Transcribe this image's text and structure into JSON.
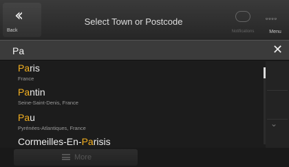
{
  "header": {
    "back_label": "Back",
    "title": "Select Town or Postcode",
    "notifications_label": "Notifications",
    "menu_label": "Menu"
  },
  "search": {
    "value": "Pa"
  },
  "results": [
    {
      "pre": "",
      "match": "Pa",
      "post": "ris",
      "sub": "France"
    },
    {
      "pre": "",
      "match": "Pa",
      "post": "ntin",
      "sub": "Seine-Saint-Denis, France"
    },
    {
      "pre": "",
      "match": "Pa",
      "post": "u",
      "sub": "Pyrénées-Atlantiques, France"
    },
    {
      "pre": "Cormeilles-En-",
      "match": "Pa",
      "post": "risis",
      "sub": ""
    }
  ],
  "bottom": {
    "more_label": "More"
  },
  "colors": {
    "highlight": "#f5b120",
    "background": "#1c1c1c"
  }
}
